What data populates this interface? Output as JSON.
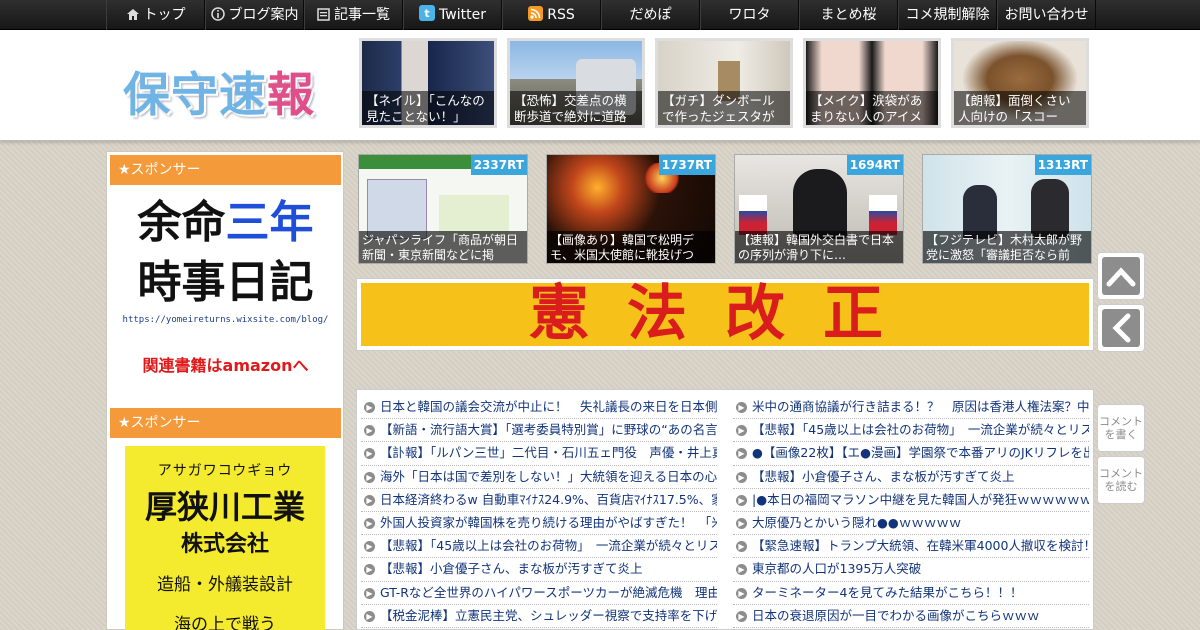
{
  "nav": {
    "items": [
      {
        "label": "トップ",
        "icon": "home-icon"
      },
      {
        "label": "ブログ案内",
        "icon": "info-icon"
      },
      {
        "label": "記事一覧",
        "icon": "list-icon"
      },
      {
        "label": "Twitter",
        "icon": "twitter-icon"
      },
      {
        "label": "RSS",
        "icon": "rss-icon"
      },
      {
        "label": "だめぽ"
      },
      {
        "label": "ワロタ"
      },
      {
        "label": "まとめ桜"
      },
      {
        "label": "コメ規制解除"
      },
      {
        "label": "お問い合わせ"
      }
    ]
  },
  "header": {
    "logo_main": "保守速",
    "logo_accent": "報",
    "featured": [
      {
        "caption": "【ネイル】「こんなの見たことない！」"
      },
      {
        "caption": "【恐怖】交差点の横断歩道で絶対に道路"
      },
      {
        "caption": "【ガチ】ダンボールで作ったジェスタが"
      },
      {
        "caption": "【メイク】涙袋があまりない人のアイメ"
      },
      {
        "caption": "【朗報】面倒くさい人向けの「スコー"
      }
    ]
  },
  "sidebar": {
    "sponsor_label": "★スポンサー",
    "ad1": {
      "line1_a": "余命",
      "line1_b": "三年",
      "line2": "時事日記",
      "url": "https://yomeireturns.wixsite.com/blog/",
      "amazon": "関連書籍はamazonへ"
    },
    "ad2": {
      "kana": "アサガワコウギョウ",
      "name": "厚狭川工業",
      "corp": "株式会社",
      "biz": "造船・外艤装設計",
      "more": "海の上で戦う"
    }
  },
  "rt_cards": [
    {
      "count": "2337RT",
      "caption": "ジャパンライフ「商品が朝日新聞・東京新聞などに掲"
    },
    {
      "count": "1737RT",
      "caption": "【画像あり】韓国で松明デモ、米国大使館に靴投げつ"
    },
    {
      "count": "1694RT",
      "caption": "【速報】韓国外交白書で日本の序列が滑り下に…"
    },
    {
      "count": "1313RT",
      "caption": "【フジテレビ】木村太郎が野党に激怒「審議拒否なら前"
    }
  ],
  "banner": {
    "text": "憲法改正"
  },
  "news": {
    "left": [
      "日本と韓国の議会交流が中止に！　失礼議長の来日を日本側が",
      "【新語・流行語大賞】「選考委員特別賞」に野球の“あの名言”",
      "【訃報】「ルパン三世」二代目・石川五ェ門役　声優・井上真",
      "海外「日本は国で差別をしない！」大統領を迎える日本の心構",
      "日本経済終わるw 自動車ﾏｲﾅｽ24.9%、百貨店ﾏｲﾅｽ17.5%、家電ﾏｲ",
      "外国人投資家が韓国株を売り続ける理由がやばすぎた！　「米",
      "【悲報】「45歳以上は会社のお荷物」　一流企業が続々とリス",
      "【悲報】小倉優子さん、まな板が汚すぎて炎上",
      "GT-Rなど全世界のハイパワースポーツカーが絶滅危機　理由は",
      "【税金泥棒】立憲民主党、シュレッダー視察で支持率を下げる"
    ],
    "right": [
      "米中の通商協議が行き詰まる！？　原因は香港人権法案？中国",
      "【悲報】「45歳以上は会社のお荷物」　一流企業が続々とリス",
      "●【画像22枚】【エ●漫画】学園祭で本番アリのJKリフレを出店",
      "【悲報】小倉優子さん、まな板が汚すぎて炎上",
      "|●本日の福岡マラソン中継を見た韓国人が発狂ｗｗｗｗｗｗ",
      "大原優乃とかいう隠れ●●ｗｗｗｗｗ",
      "【緊急速報】トランプ大統領、在韓米軍4000人撤収を検討！！",
      "東京都の人口が1395万人突破",
      "ターミネーター4を見てみた結果がこちら！！！",
      "日本の衰退原因が一目でわかる画像がこちらｗｗｗ"
    ]
  },
  "right_buttons": {
    "comment_write": "コメントを書く",
    "comment_read": "コメントを読む"
  }
}
